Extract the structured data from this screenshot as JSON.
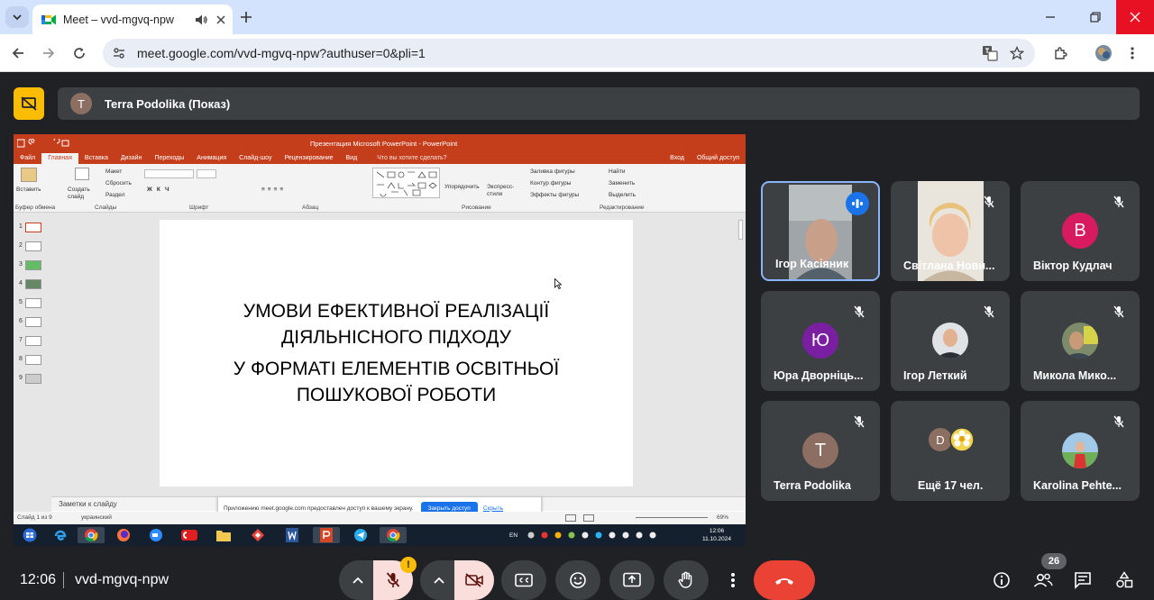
{
  "browser": {
    "tab_title": "Meet – vvd-mgvq-npw",
    "url": "meet.google.com/vvd-mgvq-npw?authuser=0&pli=1"
  },
  "meet": {
    "presenter_initial": "T",
    "presenter_label": "Terra Podolika (Показ)",
    "meeting_time": "12:06",
    "meeting_code": "vvd-mgvq-npw",
    "people_count": "26",
    "mic_warning": "!"
  },
  "powerpoint": {
    "window_title": "Презентация Microsoft PowerPoint - PowerPoint",
    "tabs": [
      "Файл",
      "Главная",
      "Вставка",
      "Дизайн",
      "Переходы",
      "Анимация",
      "Слайд-шоу",
      "Рецензирование",
      "Вид"
    ],
    "tell_me": "Что вы хотите сделать?",
    "sign_in": "Вход",
    "share": "Общий доступ",
    "ribbon_groups": [
      "Буфер обмена",
      "Слайды",
      "Шрифт",
      "Абзац",
      "Рисование",
      "Редактирование"
    ],
    "ribbon_buttons": {
      "paste": "Вставить",
      "new_slide": "Создать слайд",
      "layout": "Макет",
      "reset": "Сбросить",
      "section": "Раздел",
      "arrange": "Упорядочить",
      "quick_styles": "Экспресс-стили",
      "shape_fill": "Заливка фигуры",
      "shape_outline": "Контур фигуры",
      "shape_effects": "Эффекты фигуры",
      "find": "Найти",
      "replace": "Заменить",
      "select": "Выделить"
    },
    "slide_numbers": [
      "1",
      "2",
      "3",
      "4",
      "5",
      "6",
      "7",
      "8",
      "9"
    ],
    "slide_text": {
      "line1": "УМОВИ ЕФЕКТИВНОЇ РЕАЛІЗАЦІЇ",
      "line2": "ДІЯЛЬНІСНОГО ПІДХОДУ",
      "line3": "У ФОРМАТІ ЕЛЕМЕНТІВ ОСВІТНЬОЇ",
      "line4": "ПОШУКОВОЇ РОБОТИ"
    },
    "notes_label": "Заметки к слайду",
    "status_slide": "Слайд 1 из 9",
    "status_lang": "украинский",
    "zoom": "69%",
    "share_banner": {
      "message": "Приложению meet.google.com предоставлен доступ к вашему экрану.",
      "stop": "Закрыть доступ",
      "hide": "Скрыть"
    },
    "taskbar_lang": "EN",
    "taskbar_time": "12:06",
    "taskbar_date": "11.10.2024"
  },
  "participants": [
    {
      "name": "Ігор Касіяник",
      "type": "video",
      "speaking": true
    },
    {
      "name": "Світлана Нови...",
      "type": "video",
      "muted": true
    },
    {
      "name": "Віктор Кудлач",
      "type": "avatar",
      "initial": "В",
      "color": "#d81b60",
      "muted": true
    },
    {
      "name": "Юра Дворніць...",
      "type": "avatar",
      "initial": "Ю",
      "color": "#7b1fa2",
      "muted": true
    },
    {
      "name": "Ігор Леткий",
      "type": "photo",
      "muted": true
    },
    {
      "name": "Микола Мико...",
      "type": "photo",
      "muted": true
    },
    {
      "name": "Terra Podolika",
      "type": "avatar",
      "initial": "T",
      "color": "#8d6e63",
      "muted": true
    },
    {
      "name": "Ещё 17 чел.",
      "type": "more",
      "initial": "D"
    },
    {
      "name": "Karolina Pehte...",
      "type": "photo",
      "muted": true
    }
  ],
  "colors": {
    "meet_bg": "#202124",
    "tile_bg": "#3c4043",
    "end_call": "#ea4335",
    "mic_off": "#f9dedc",
    "powerpoint": "#c43e1c",
    "chrome_tabstrip": "#d3e3fd"
  }
}
